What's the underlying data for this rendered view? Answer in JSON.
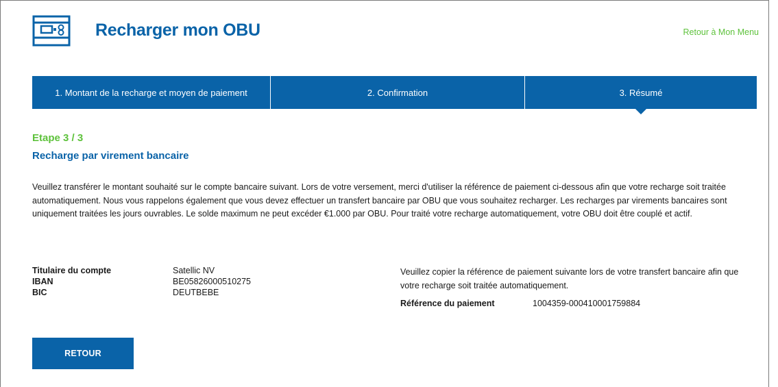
{
  "header": {
    "logo_icon": "obu-device-icon",
    "title": "Recharger mon OBU",
    "back_link": "Retour à Mon Menu"
  },
  "steps": [
    {
      "label": "1. Montant de la recharge et moyen de paiement",
      "active": false
    },
    {
      "label": "2. Confirmation",
      "active": false
    },
    {
      "label": "3. Résumé",
      "active": true
    }
  ],
  "main": {
    "step_indicator": "Etape 3 / 3",
    "subtitle": "Recharge par virement bancaire",
    "description": "Veuillez transférer le montant souhaité sur le compte bancaire suivant. Lors de votre versement, merci d'utiliser la référence de paiement ci-dessous afin que votre recharge soit traitée automatiquement. Nous vous rappelons également que vous devez effectuer un transfert bancaire par OBU que vous souhaitez recharger. Les recharges par virements bancaires sont uniquement traitées les jours ouvrables. Le solde maximum ne peut excéder €1.000 par OBU. Pour traité votre recharge automatiquement, votre OBU doit être couplé et actif.",
    "account": [
      {
        "label": "Titulaire du compte",
        "value": "Satellic NV"
      },
      {
        "label": "IBAN",
        "value": "BE05826000510275"
      },
      {
        "label": "BIC",
        "value": "DEUTBEBE"
      }
    ],
    "reference_instruction": "Veuillez copier la référence de paiement suivante lors de votre transfert bancaire afin que votre recharge soit traitée automatiquement.",
    "reference_label": "Référence du paiement",
    "reference_value": "1004359-000410001759884"
  },
  "actions": {
    "back_button": "RETOUR"
  },
  "colors": {
    "primary": "#0a63a8",
    "accent_green": "#5ec23c"
  }
}
